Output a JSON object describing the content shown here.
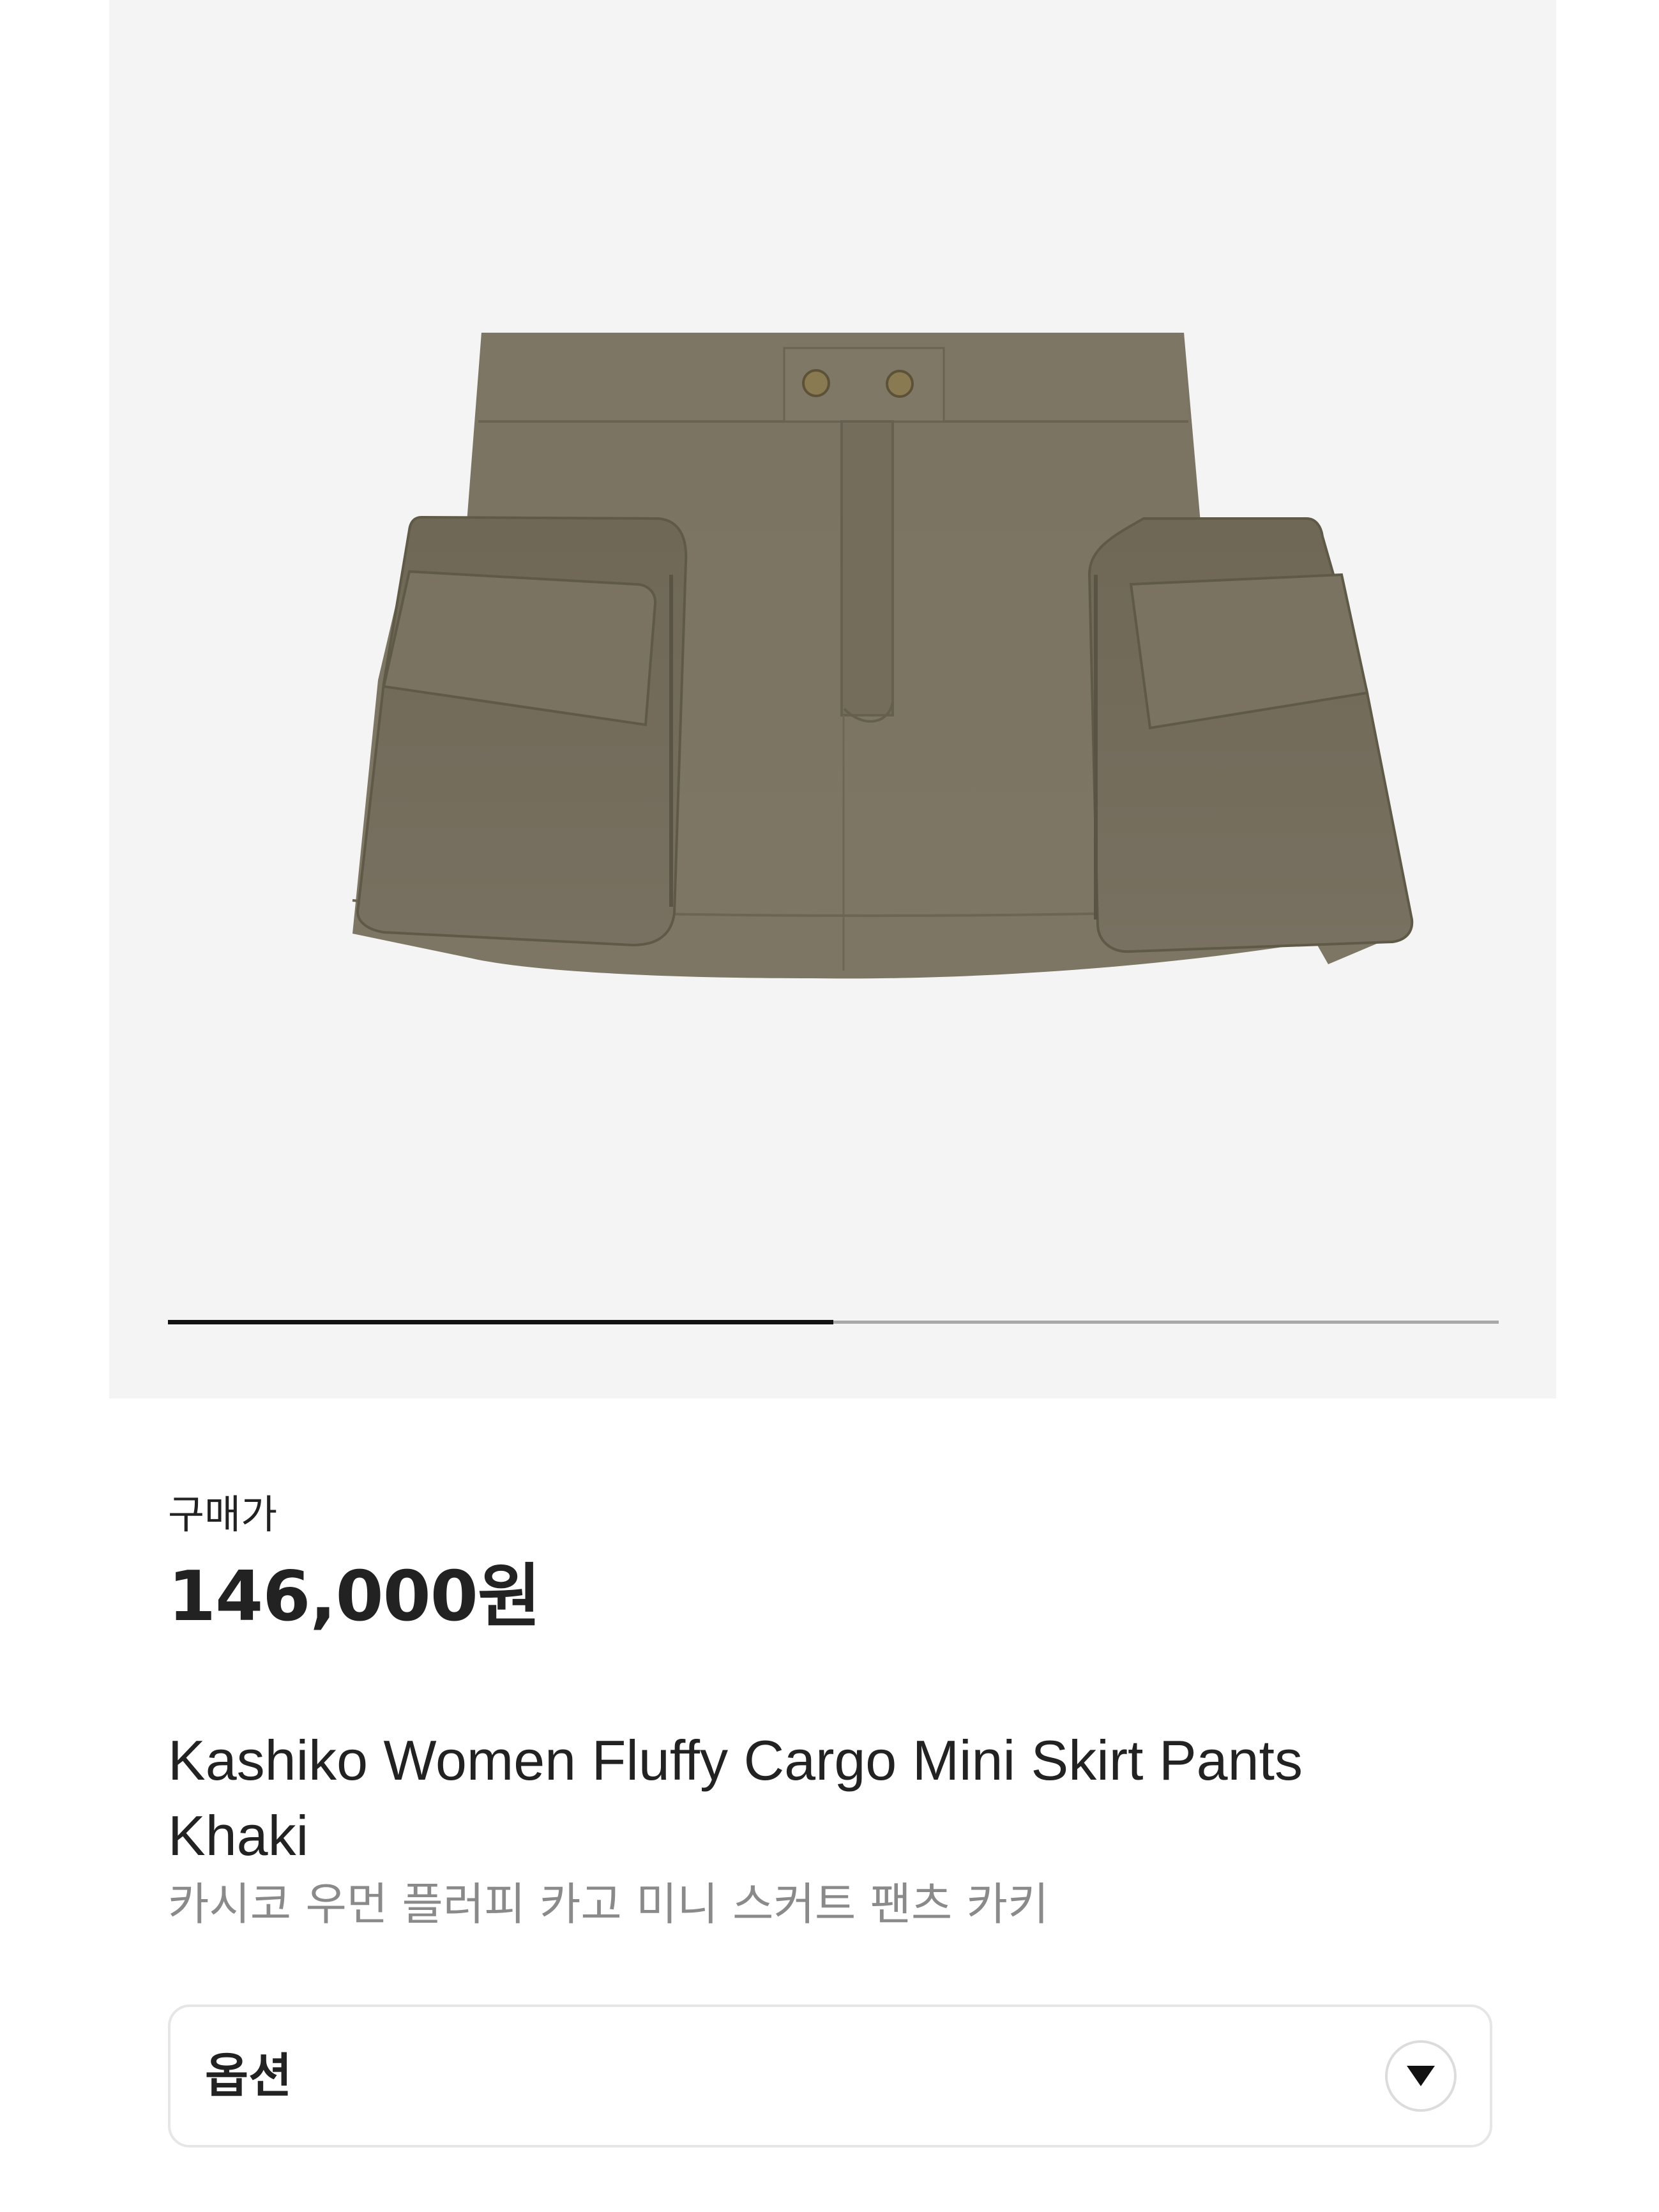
{
  "gallery": {
    "image_alt": "skirt",
    "slide_progress": 0.5
  },
  "price": {
    "label": "구매가",
    "value": "146,000원"
  },
  "product": {
    "name_en": "Kashiko Women Fluffy Cargo Mini Skirt Pants Khaki",
    "name_ko": "카시코 우먼 플러피 카고 미니 스커트 팬츠 카키"
  },
  "option": {
    "label": "옵션",
    "icon": "chevron-down-icon"
  },
  "colors": {
    "gallery_bg": "#f4f4f4",
    "skirt": "#7a7261",
    "progress_active": "#111111",
    "progress_track": "#a8a8a8"
  }
}
